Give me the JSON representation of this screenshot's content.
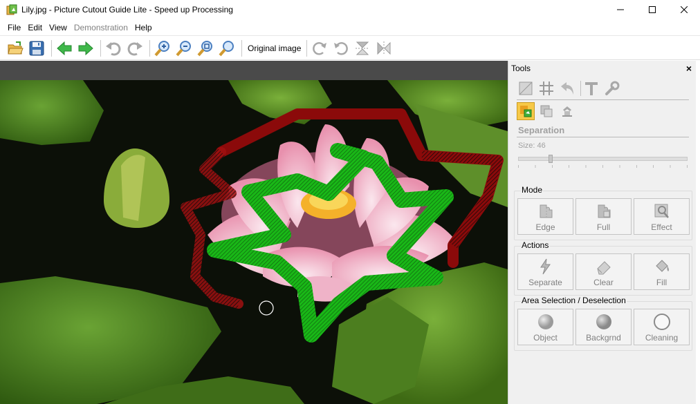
{
  "window": {
    "title": "Lily.jpg - Picture Cutout Guide Lite - Speed up Processing",
    "controls": [
      "minimize",
      "maximize",
      "close"
    ]
  },
  "menu": {
    "items": [
      {
        "label": "File",
        "enabled": true
      },
      {
        "label": "Edit",
        "enabled": true
      },
      {
        "label": "View",
        "enabled": true
      },
      {
        "label": "Demonstration",
        "enabled": false
      },
      {
        "label": "Help",
        "enabled": true
      }
    ]
  },
  "toolbar": {
    "icons": [
      "open-icon",
      "save-icon",
      "back-arrow-icon",
      "forward-arrow-icon",
      "undo-icon",
      "redo-icon",
      "zoom-in-icon",
      "zoom-out-icon",
      "zoom-fit-icon",
      "zoom-actual-icon",
      "rotate-right-icon",
      "rotate-left-icon",
      "flip-vertical-icon",
      "flip-horizontal-icon"
    ],
    "original_image_label": "Original image"
  },
  "tools": {
    "title": "Tools",
    "close_glyph": "×",
    "section": "Separation",
    "size_label": "Size: 46",
    "size_value": 46,
    "size_max": 250,
    "mode": {
      "title": "Mode",
      "buttons": [
        {
          "label": "Edge"
        },
        {
          "label": "Full"
        },
        {
          "label": "Effect"
        }
      ]
    },
    "actions": {
      "title": "Actions",
      "buttons": [
        {
          "label": "Separate"
        },
        {
          "label": "Clear"
        },
        {
          "label": "Fill"
        }
      ]
    },
    "area": {
      "title": "Area Selection / Deselection",
      "buttons": [
        {
          "label": "Object"
        },
        {
          "label": "Backgrnd"
        },
        {
          "label": "Cleaning"
        }
      ]
    }
  },
  "colors": {
    "object_stroke": "#19b817",
    "background_stroke": "#8b0a0a",
    "accent": "#f7c948"
  }
}
